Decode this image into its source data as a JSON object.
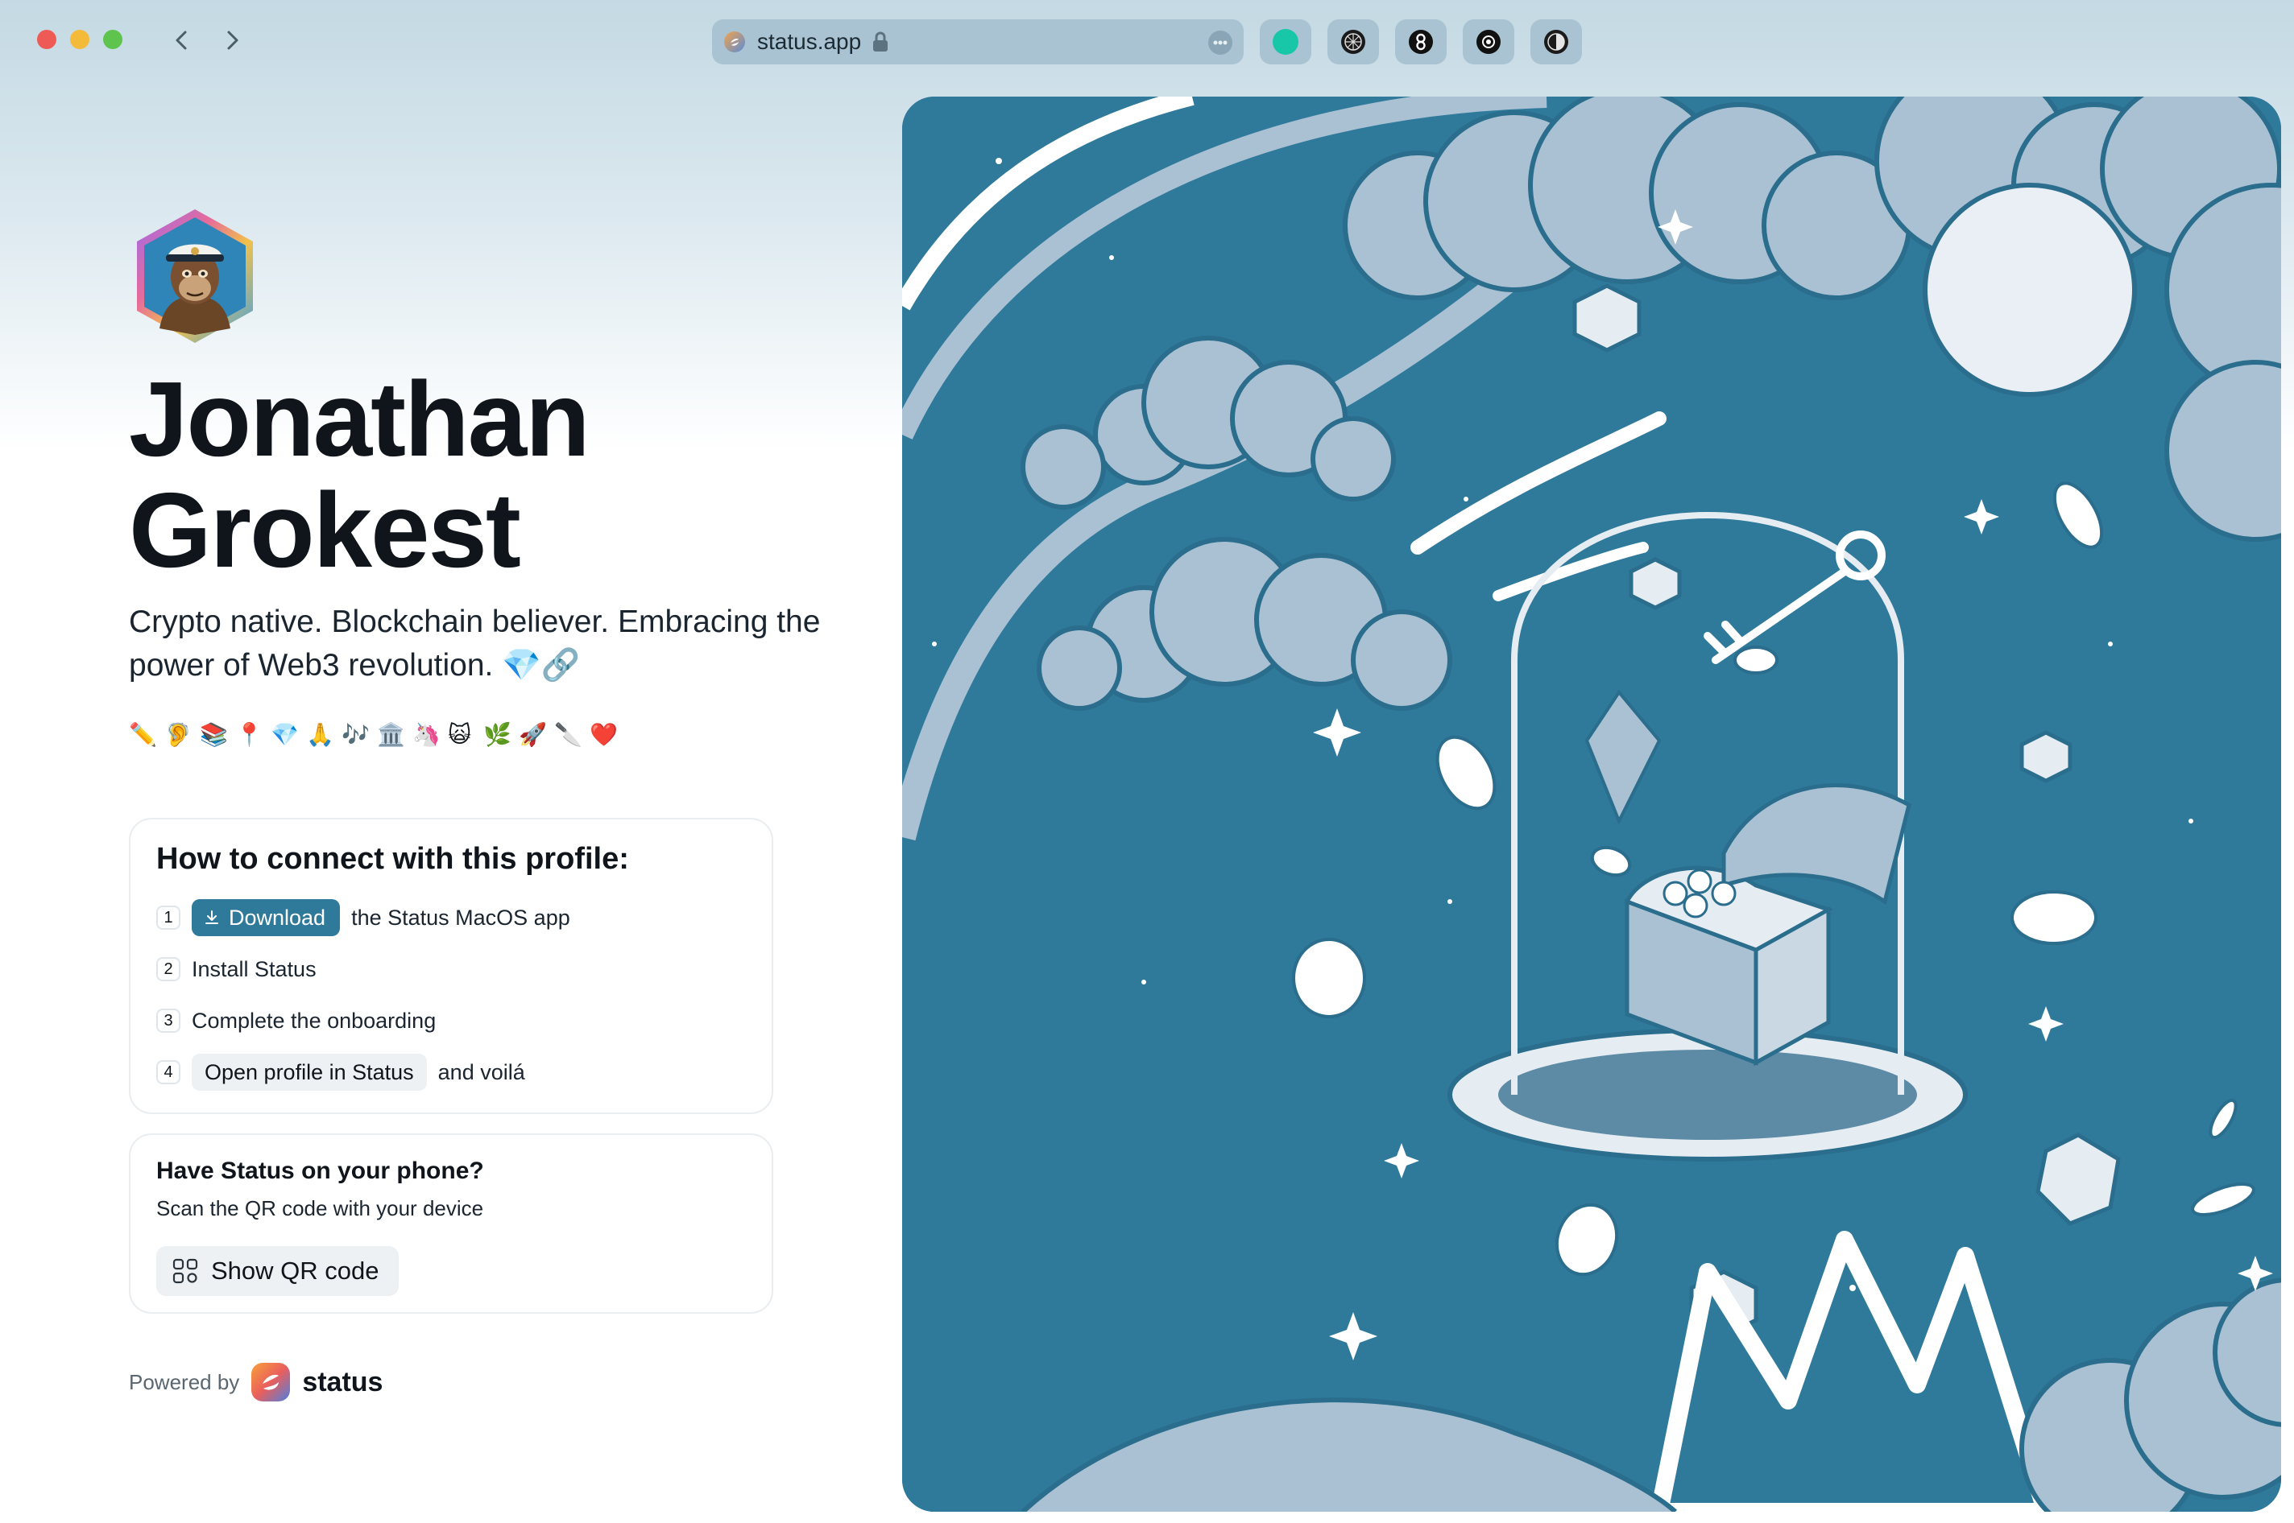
{
  "browser": {
    "url": "status.app",
    "tab_icons": [
      "sapien-icon",
      "grid-globe-icon",
      "link-icon",
      "gear-sun-icon",
      "half-circle-icon"
    ]
  },
  "profile": {
    "name_line1": "Jonathan",
    "name_line2": "Grokest",
    "bio": "Crypto native. Blockchain believer. Embracing the power of Web3 revolution. 💎🔗",
    "emojis": [
      "✏️",
      "🦻",
      "📚",
      "📍",
      "💎",
      "🙏",
      "🎶",
      "🏛️",
      "🦄",
      "🙀",
      "🌿",
      "🚀",
      "🔪",
      "❤️"
    ]
  },
  "connect": {
    "title": "How to connect with this profile:",
    "steps": [
      {
        "num": "1",
        "button": "Download",
        "text": "the Status MacOS app"
      },
      {
        "num": "2",
        "text": "Install Status"
      },
      {
        "num": "3",
        "text": "Complete the onboarding"
      },
      {
        "num": "4",
        "button": "Open profile in Status",
        "text": "and voilá"
      }
    ]
  },
  "phone": {
    "title": "Have Status on your phone?",
    "subtitle": "Scan the QR code with your device",
    "button": "Show QR code"
  },
  "footer": {
    "powered_by": "Powered by",
    "brand": "status"
  },
  "colors": {
    "accent": "#2f799b",
    "illustration_bg": "#2f799b",
    "illustration_light": "#a9c1d3"
  }
}
